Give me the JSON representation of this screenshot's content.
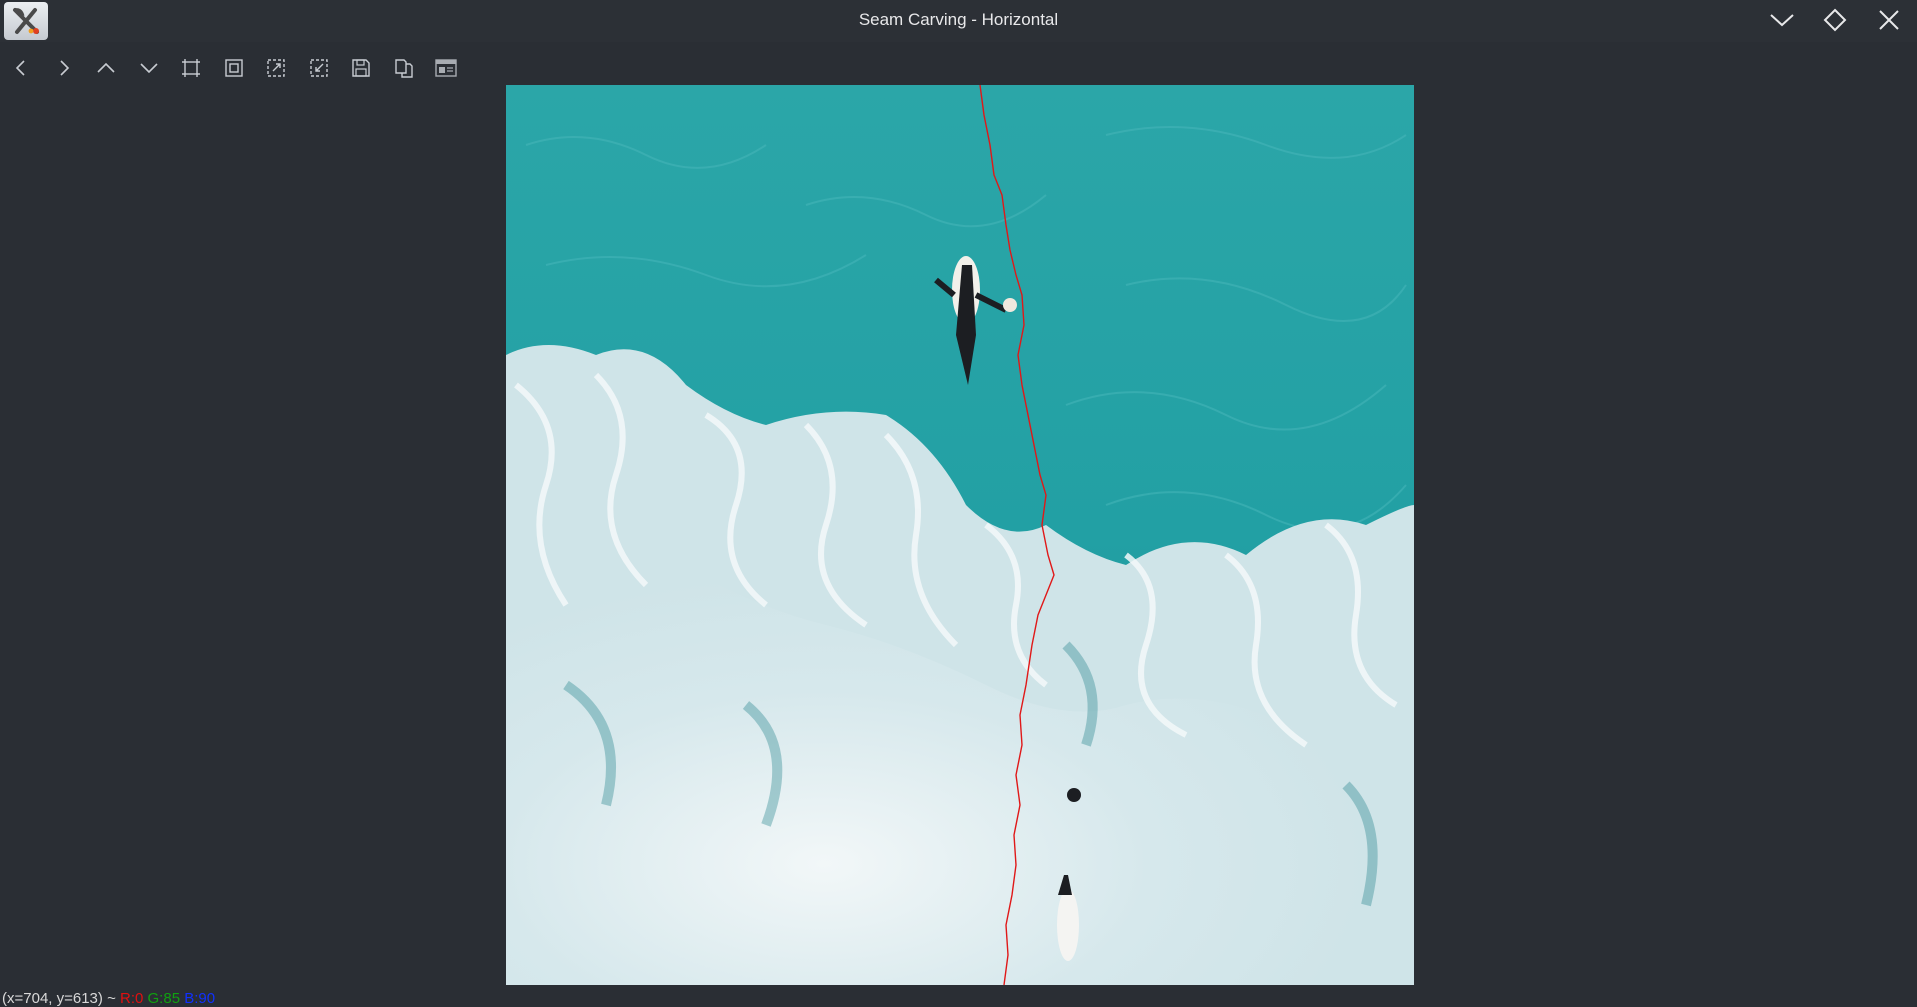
{
  "window": {
    "title": "Seam Carving - Horizontal",
    "app_icon": "opencv-x-icon",
    "controls": [
      "minimize-icon",
      "maximize-icon",
      "close-icon"
    ]
  },
  "toolbar": {
    "items": [
      {
        "name": "pan-left",
        "icon": "chevron-left-icon"
      },
      {
        "name": "pan-right",
        "icon": "chevron-right-icon"
      },
      {
        "name": "pan-up",
        "icon": "chevron-up-icon"
      },
      {
        "name": "pan-down",
        "icon": "chevron-down-icon"
      },
      {
        "name": "zoom-original",
        "icon": "zoom-original-icon"
      },
      {
        "name": "zoom-fit",
        "icon": "zoom-fit-icon"
      },
      {
        "name": "zoom-in",
        "icon": "zoom-in-icon"
      },
      {
        "name": "zoom-out",
        "icon": "zoom-out-icon"
      },
      {
        "name": "save",
        "icon": "save-icon"
      },
      {
        "name": "copy",
        "icon": "copy-icon"
      },
      {
        "name": "properties",
        "icon": "properties-icon"
      }
    ]
  },
  "image": {
    "description_colors": {
      "water": "#2aa8aa",
      "foam": "#e8f2f4",
      "seam": "#e01818"
    }
  },
  "status": {
    "coords": "(x=704, y=613) ~",
    "r": "R:0",
    "g": "G:85",
    "b": "B:90"
  },
  "colors": {
    "background": "#2a2e34",
    "title_text": "#e8e8ea",
    "icon": "#c8ccd2"
  }
}
